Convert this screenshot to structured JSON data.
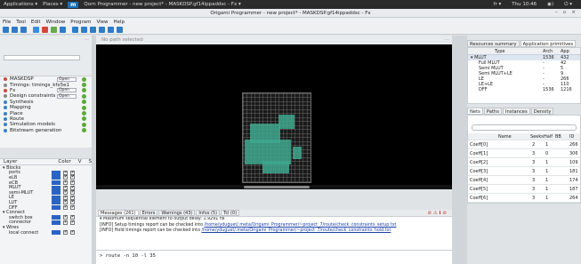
{
  "sysbar": {
    "applications": "Applications ▾",
    "places": "Places ▾",
    "logo": "m",
    "window": "Qorn Programmer - new project* - MASKDSP.gf14ippaddsc - Fx ▾",
    "right": [
      "fr ▾",
      "Thu 10:46",
      "◉)",
      "⏻ ▾"
    ]
  },
  "title": "Origami Programmer - new project* - MASKDSP.gf14ippaddsc - Fx",
  "window_buttons": [
    "–",
    "▫",
    "×"
  ],
  "menu": [
    "File",
    "Tool",
    "Edit",
    "Window",
    "Program",
    "View",
    "Help"
  ],
  "toolbar_colors": [
    "#2f7cc8",
    "#2f7cc8",
    "#2f7cc8",
    "#3a8ee0",
    "#d24a3a",
    "#6aa84f",
    "#2f7cc8",
    "#2f7cc8",
    "#2f7cc8",
    "#2f7cc8",
    "#2f7cc8",
    "#2f7cc8",
    "#2f7cc8"
  ],
  "left_dots": "⋯",
  "flow": [
    {
      "label": "MASKDSP",
      "status": "Open",
      "color": "#d24a3a"
    },
    {
      "label": "Timings: timings_kfx5e1",
      "status": "",
      "color": "#888888"
    },
    {
      "label": "Fx",
      "status": "Open",
      "color": "#d24a3a"
    },
    {
      "label": "Design constraints",
      "status": "Open",
      "color": "#888888"
    },
    {
      "label": "Synthesis",
      "status": "",
      "color": "#3a7fc8"
    },
    {
      "label": "Mapping",
      "status": "",
      "color": "#3a7fc8"
    },
    {
      "label": "Place",
      "status": "",
      "color": "#3a7fc8"
    },
    {
      "label": "Route",
      "status": "",
      "color": "#3a7fc8"
    },
    {
      "label": "Simulation models",
      "status": "",
      "color": "#3a7fc8"
    },
    {
      "label": "Bitstream generation",
      "status": "",
      "color": "#3a7fc8"
    }
  ],
  "layers_header": {
    "layer": "Layer",
    "color": "Color",
    "v": "V",
    "s": "S"
  },
  "layers": [
    {
      "label": "▾ Blocks",
      "group": true
    },
    {
      "label": "ports",
      "group": false
    },
    {
      "label": "eLB",
      "group": false
    },
    {
      "label": "eCB",
      "group": false
    },
    {
      "label": "MLUT",
      "group": false
    },
    {
      "label": "semi-MLUT",
      "group": false
    },
    {
      "label": "LE",
      "group": false
    },
    {
      "label": "LUT",
      "group": false
    },
    {
      "label": "DFF",
      "group": false
    },
    {
      "label": "▾ Connect",
      "group": true
    },
    {
      "label": "switch box",
      "group": false
    },
    {
      "label": "connector",
      "group": false
    },
    {
      "label": "▾ Wires",
      "group": true
    },
    {
      "label": "local connect",
      "group": false
    }
  ],
  "canvas_bar": "No path selected",
  "msg_tabs": [
    "Messages (261)",
    "Errors",
    "Warnings (43)",
    "Infos (5)",
    "Tcl (0)"
  ],
  "msg_icons": "⊘ ⚠ ℹ ⊘",
  "messages": [
    {
      "prefix": "  ▾ Maximum sequential element to output delay: 1.9291 ns",
      "link": "",
      "suffix": ""
    },
    {
      "prefix": "[INFO] Setup timings report can be checked into ",
      "link": "/home/yduguet/.meta/Origami_Programmer/~project_7/route/check_constraints_setup.txt",
      "suffix": ""
    },
    {
      "prefix": "[INFO] Hold timings report can be checked into ",
      "link": "/home/yduguet/.meta/Origami_Programmer/~project_7/route/check_constraints_hold.txt",
      "suffix": ""
    }
  ],
  "console": "> route -n 10 -l 35",
  "right_tabs": [
    "Resources summary",
    "Application primitives"
  ],
  "resources": {
    "header": {
      "type": "Type",
      "arch": "Arch",
      "app": "App"
    },
    "rows": [
      {
        "name": "▾ MLUT",
        "arch": "1536",
        "app": "432"
      },
      {
        "name": "Full MLUT",
        "arch": "-",
        "app": "42"
      },
      {
        "name": "Semi MLUT",
        "arch": "-",
        "app": "5"
      },
      {
        "name": "Semi MLUT+LE",
        "arch": "-",
        "app": "9"
      },
      {
        "name": "LE",
        "arch": "-",
        "app": "266"
      },
      {
        "name": "LE+LE",
        "arch": "-",
        "app": "110"
      },
      {
        "name": "DFF",
        "arch": "1536",
        "app": "1216"
      }
    ]
  },
  "path_tabs": [
    "Nets",
    "Paths",
    "Instances",
    "Density"
  ],
  "paths": {
    "header": {
      "name": "Name",
      "seeks": "Seeks",
      "half": "Half",
      "bb": "BB",
      "id": "ID"
    },
    "rows": [
      {
        "name": "Coeff[0]",
        "seeks": "2",
        "half": "1",
        "bb": "",
        "id": "266"
      },
      {
        "name": "Coeff[1]",
        "seeks": "3",
        "half": "0",
        "bb": "",
        "id": "306"
      },
      {
        "name": "Coeff[2]",
        "seeks": "3",
        "half": "1",
        "bb": "",
        "id": "109"
      },
      {
        "name": "Coeff[3]",
        "seeks": "3",
        "half": "1",
        "bb": "",
        "id": "181"
      },
      {
        "name": "Coeff[4]",
        "seeks": "3",
        "half": "1",
        "bb": "",
        "id": "174"
      },
      {
        "name": "Coeff[5]",
        "seeks": "3",
        "half": "1",
        "bb": "",
        "id": "187"
      },
      {
        "name": "Coeff[6]",
        "seeks": "3",
        "half": "1",
        "bb": "",
        "id": "264"
      }
    ]
  }
}
